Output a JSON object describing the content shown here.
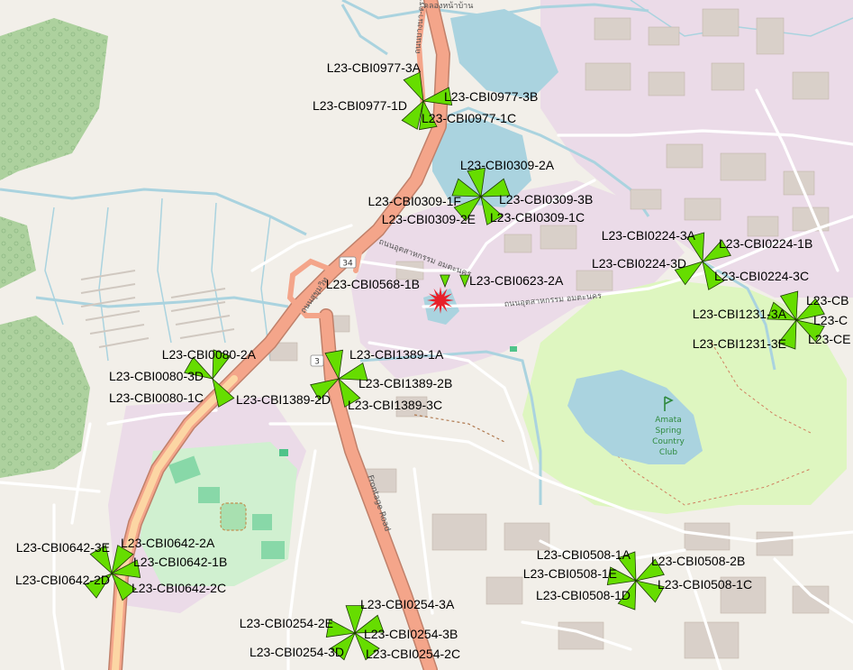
{
  "sector_color": "#66dd00",
  "incident_color": "#e8202a",
  "road_shields": [
    {
      "id": "shield-34",
      "label": "34"
    },
    {
      "id": "shield-3",
      "label": "3"
    }
  ],
  "road_labels": {
    "frontage": "Frontage Road",
    "thai_bangna": "ถนนบางนา-ตราด",
    "thai_sukhumvit": "ถนนสุขุมวิท",
    "thai_amata1": "ถนนอุตสาหกรรม อมตะนคร",
    "thai_amata2": "ถนนอุตสาหกรรม อมตะนคร",
    "thai_canal": "คลองหน้าบ้าน"
  },
  "poi": {
    "amata_line1": "Amata",
    "amata_line2": "Spring",
    "amata_line3": "Country",
    "amata_line4": "Club"
  },
  "incident": {
    "name": "incident-marker"
  },
  "sites": [
    {
      "id": "CBI0977",
      "labels": [
        "L23-CBI0977-3A",
        "L23-CBI0977-3B",
        "L23-CBI0977-1D",
        "L23-CBI0977-1C"
      ]
    },
    {
      "id": "CBI0309",
      "labels": [
        "L23-CBI0309-2A",
        "L23-CBI0309-1F",
        "L23-CBI0309-3B",
        "L23-CBI0309-2E",
        "L23-CBI0309-1C"
      ]
    },
    {
      "id": "CBI0224",
      "labels": [
        "L23-CBI0224-3A",
        "L23-CBI0224-1B",
        "L23-CBI0224-3D",
        "L23-CBI0224-3C"
      ]
    },
    {
      "id": "CBI0623",
      "labels": [
        "L23-CBI0623-2A"
      ]
    },
    {
      "id": "CBI0568",
      "labels": [
        "L23-CBI0568-1B"
      ]
    },
    {
      "id": "CBI1231",
      "labels": [
        "L23-CB",
        "L23-CBI1231-3A",
        "L23-C",
        "L23-CBI1231-3E",
        "L23-CE"
      ]
    },
    {
      "id": "CBI0080",
      "labels": [
        "L23-CBI0080-2A",
        "L23-CBI0080-3D",
        "L23-CBI0080-1C"
      ]
    },
    {
      "id": "CBI1389",
      "labels": [
        "L23-CBI1389-1A",
        "L23-CBI1389-2B",
        "L23-CBI1389-2D",
        "L23-CBI1389-3C"
      ]
    },
    {
      "id": "CBI0642",
      "labels": [
        "L23-CBI0642-3E",
        "L23-CBI0642-2A",
        "L23-CBI0642-1B",
        "L23-CBI0642-2D",
        "L23-CBI0642-2C"
      ]
    },
    {
      "id": "CBI0508",
      "labels": [
        "L23-CBI0508-1A",
        "L23-CBI0508-2B",
        "L23-CBI0508-1E",
        "L23-CBI0508-1D",
        "L23-CBI0508-1C"
      ]
    },
    {
      "id": "CBI0254",
      "labels": [
        "L23-CBI0254-3A",
        "L23-CBI0254-2E",
        "L23-CBI0254-3B",
        "L23-CBI0254-3D",
        "L23-CBI0254-2C"
      ]
    }
  ]
}
